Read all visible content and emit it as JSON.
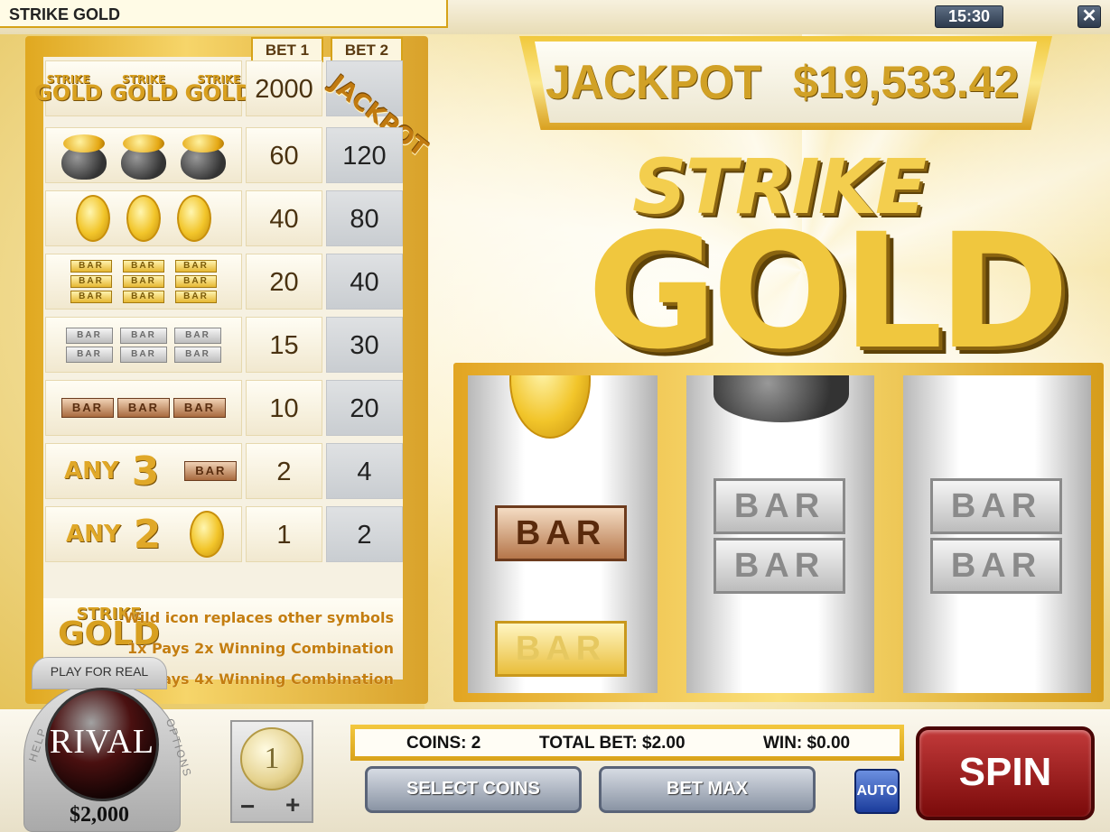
{
  "window": {
    "title": "STRIKE GOLD",
    "clock": "15:30",
    "close_label": "✕"
  },
  "paytable": {
    "bet1_label": "BET 1",
    "bet2_label": "BET 2",
    "jackpot_stamp": "JACKPOT",
    "logo_top": "STRIKE",
    "logo_bottom": "GOLD",
    "rows": [
      {
        "symbol": "3x Strike Gold logo",
        "bet1": "2000",
        "bet2": ""
      },
      {
        "symbol": "3x pot of gold",
        "bet1": "60",
        "bet2": "120"
      },
      {
        "symbol": "3x gold coin",
        "bet1": "40",
        "bet2": "80"
      },
      {
        "symbol": "3x triple gold bar",
        "bet1": "20",
        "bet2": "40"
      },
      {
        "symbol": "3x double silver bar",
        "bet1": "15",
        "bet2": "30"
      },
      {
        "symbol": "3x single bronze bar",
        "bet1": "10",
        "bet2": "20"
      },
      {
        "symbol": "any 3 bar",
        "bet1": "2",
        "bet2": "4"
      },
      {
        "symbol": "any 2 coin",
        "bet1": "1",
        "bet2": "2"
      }
    ],
    "any_label": "ANY",
    "any3_num": "3",
    "any2_num": "2",
    "bar_text": "BAR",
    "info": [
      "Wild icon replaces other symbols",
      "1x Pays 2x Winning Combination",
      "2x Pays 4x Winning Combination"
    ]
  },
  "jackpot": {
    "label": "JACKPOT",
    "value": "$19,533.42"
  },
  "logo": {
    "strike": "STRIKE",
    "gold": "GOLD"
  },
  "reels": {
    "bar_text": "BAR"
  },
  "bottom": {
    "play_for_real": "PLAY FOR REAL",
    "brand": "RIVAL",
    "help": "HELP",
    "options": "OPTIONS",
    "balance": "$2,000",
    "coin_value": "1",
    "coin_minus": "−",
    "coin_plus": "+",
    "coins": "COINS: 2",
    "total_bet": "TOTAL BET: $2.00",
    "win": "WIN: $0.00",
    "select_coins": "SELECT COINS",
    "bet_max": "BET MAX",
    "auto": "AUTO",
    "spin": "SPIN"
  },
  "colors": {
    "gold": "#d8a020",
    "spin_red": "#a01818",
    "button_gray": "#8a94a4",
    "auto_blue": "#1b3c9c"
  }
}
